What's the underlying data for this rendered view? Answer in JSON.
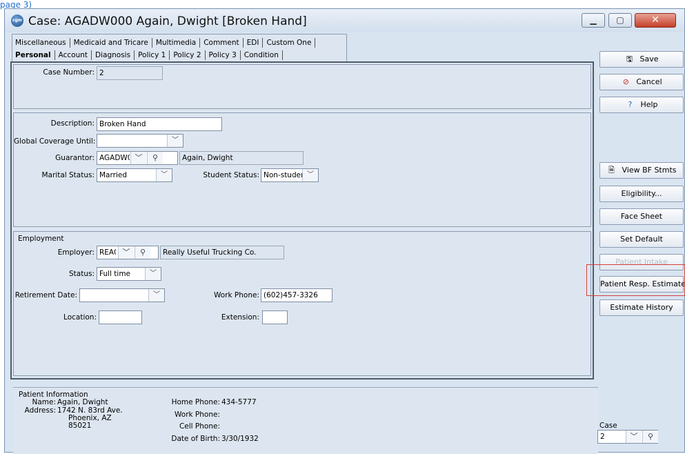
{
  "top_link": "page 3)",
  "window": {
    "title": "Case: AGADW000 Again, Dwight  [Broken Hand]",
    "logo": "cgm",
    "controls": [
      "minimize",
      "maximize",
      "close"
    ]
  },
  "tabs_row1": [
    "Miscellaneous",
    "Medicaid and Tricare",
    "Multimedia",
    "Comment",
    "EDI",
    "Custom One"
  ],
  "tabs_row2": [
    "Personal",
    "Account",
    "Diagnosis",
    "Policy 1",
    "Policy 2",
    "Policy 3",
    "Condition"
  ],
  "active_tab": "Personal",
  "case_section": {
    "case_number_label": "Case Number:",
    "case_number": "2"
  },
  "personal": {
    "description_label": "Description:",
    "description": "Broken Hand",
    "global_coverage_label": "Global Coverage Until:",
    "global_coverage": "",
    "guarantor_label": "Guarantor:",
    "guarantor_code": "AGADW00(",
    "guarantor_name": "Again, Dwight",
    "marital_label": "Marital Status:",
    "marital": "Married",
    "student_label": "Student Status:",
    "student": "Non-studer"
  },
  "employment": {
    "heading": "Employment",
    "employer_label": "Employer:",
    "employer_code": "REA0(",
    "employer_name": "Really Useful Trucking Co.",
    "status_label": "Status:",
    "status": "Full time",
    "retirement_label": "Retirement Date:",
    "retirement": "",
    "work_phone_label": "Work Phone:",
    "work_phone": "(602)457-3326",
    "location_label": "Location:",
    "location": "",
    "extension_label": "Extension:",
    "extension": ""
  },
  "side_buttons": {
    "save": "Save",
    "cancel": "Cancel",
    "help": "Help",
    "view_bf": "View BF Stmts",
    "eligibility": "Eligibility...",
    "face_sheet": "Face Sheet",
    "set_default": "Set Default",
    "patient_intake": "Patient Intake",
    "patient_resp": "Patient Resp. Estimate",
    "estimate_history": "Estimate History"
  },
  "patient_info": {
    "heading": "Patient Information",
    "name_label": "Name:",
    "name": "Again, Dwight",
    "address_label": "Address:",
    "address1": "1742 N. 83rd Ave.",
    "address2": "Phoenix, AZ",
    "address3": "85021",
    "home_phone_label": "Home Phone:",
    "home_phone": "434-5777",
    "work_phone_label": "Work Phone:",
    "work_phone": "",
    "cell_phone_label": "Cell Phone:",
    "cell_phone": "",
    "dob_label": "Date of Birth:",
    "dob": "3/30/1932"
  },
  "case_selector": {
    "label": "Case",
    "value": "2"
  },
  "colors": {
    "window_bg": "#d9e4f1",
    "highlight": "#d3433b",
    "link": "#1f6fd1"
  }
}
